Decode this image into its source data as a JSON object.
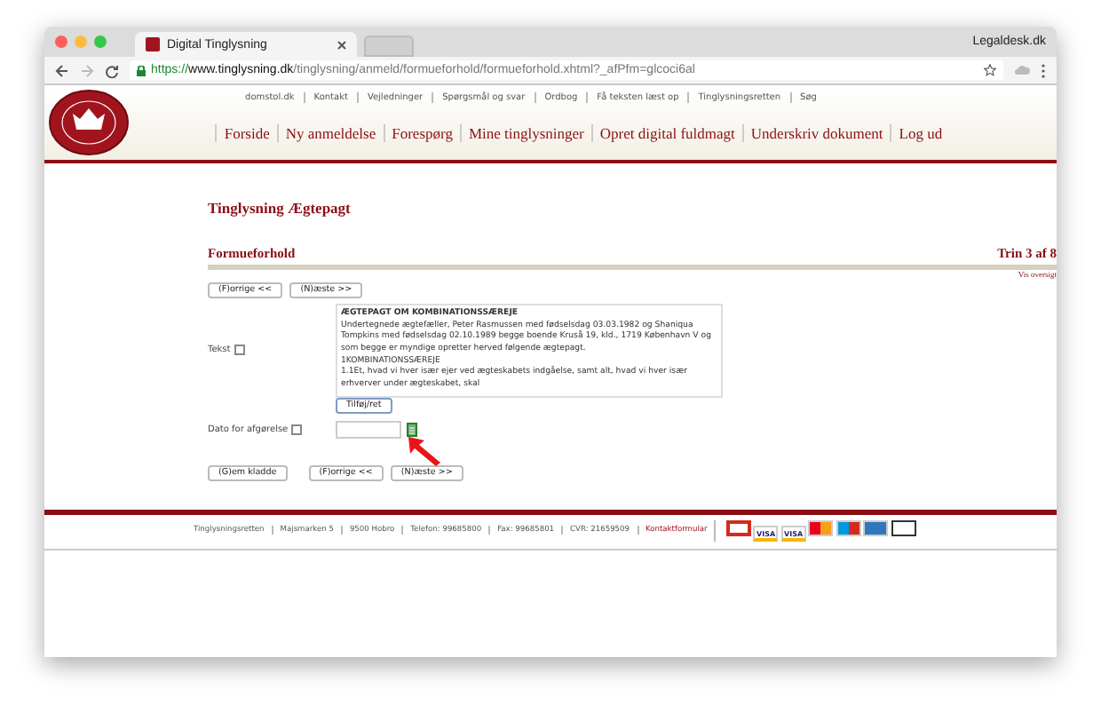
{
  "browser": {
    "tab_title": "Digital Tinglysning",
    "profile": "Legaldesk.dk",
    "url_scheme": "https://",
    "url_host": "www.tinglysning.dk",
    "url_path": "/tinglysning/anmeld/formueforhold/formueforhold.xhtml?_afPfm=glcoci6al"
  },
  "top_links": [
    "domstol.dk",
    "Kontakt",
    "Vejledninger",
    "Spørgsmål og svar",
    "Ordbog",
    "Få teksten læst op",
    "Tinglysningsretten",
    "Søg"
  ],
  "nav": [
    "Forside",
    "Ny anmeldelse",
    "Forespørg",
    "Mine tinglysninger",
    "Opret digital fuldmagt",
    "Underskriv dokument",
    "Log ud"
  ],
  "page_title": "Tinglysning Ægtepagt",
  "section_title": "Formueforhold",
  "step": "Trin 3 af 8",
  "overview_link": "Vis oversigt",
  "top_buttons": [
    "(F)orrige <<",
    "(N)æste >>"
  ],
  "text_field": {
    "label": "Tekst",
    "heading": "ÆGTEPAGT OM KOMBINATIONSSÆREJE",
    "lines": [
      "Undertegnede ægtefæller, Peter Rasmussen med fødselsdag 03.03.1982 og Shaniqua Tompkins med fødselsdag 02.10.1989 begge boende Kruså 19, kld., 1719 København V og som begge er myndige opretter herved følgende ægtepagt.",
      "1KOMBINATIONSSÆREJE",
      "1.1Et, hvad vi hver især ejer ved ægteskabets indgåelse, samt alt, hvad vi hver især erhverver under ægteskabet, skal"
    ],
    "edit_button": "Tilføj/ret"
  },
  "date_field": {
    "label": "Dato for afgørelse"
  },
  "bottom_buttons": [
    "(G)em kladde",
    "(F)orrige <<",
    "(N)æste >>"
  ],
  "footer": [
    {
      "text": "Tinglysningsretten",
      "kind": "plain"
    },
    {
      "text": "Majsmarken 5",
      "kind": "plain"
    },
    {
      "text": "9500 Hobro",
      "kind": "plain"
    },
    {
      "text": "Telefon: 99685800",
      "kind": "plain"
    },
    {
      "text": "Fax: 99685801",
      "kind": "plain"
    },
    {
      "text": "CVR: 21659509",
      "kind": "plain"
    },
    {
      "text": "Kontaktformular",
      "kind": "link"
    }
  ],
  "payment_cards": [
    {
      "kind": "dankort"
    },
    {
      "kind": "visa",
      "label": "VISA"
    },
    {
      "kind": "visa",
      "label": "VISA"
    },
    {
      "kind": "mastercard"
    },
    {
      "kind": "maestro"
    },
    {
      "kind": "amex"
    },
    {
      "kind": "seal"
    }
  ]
}
